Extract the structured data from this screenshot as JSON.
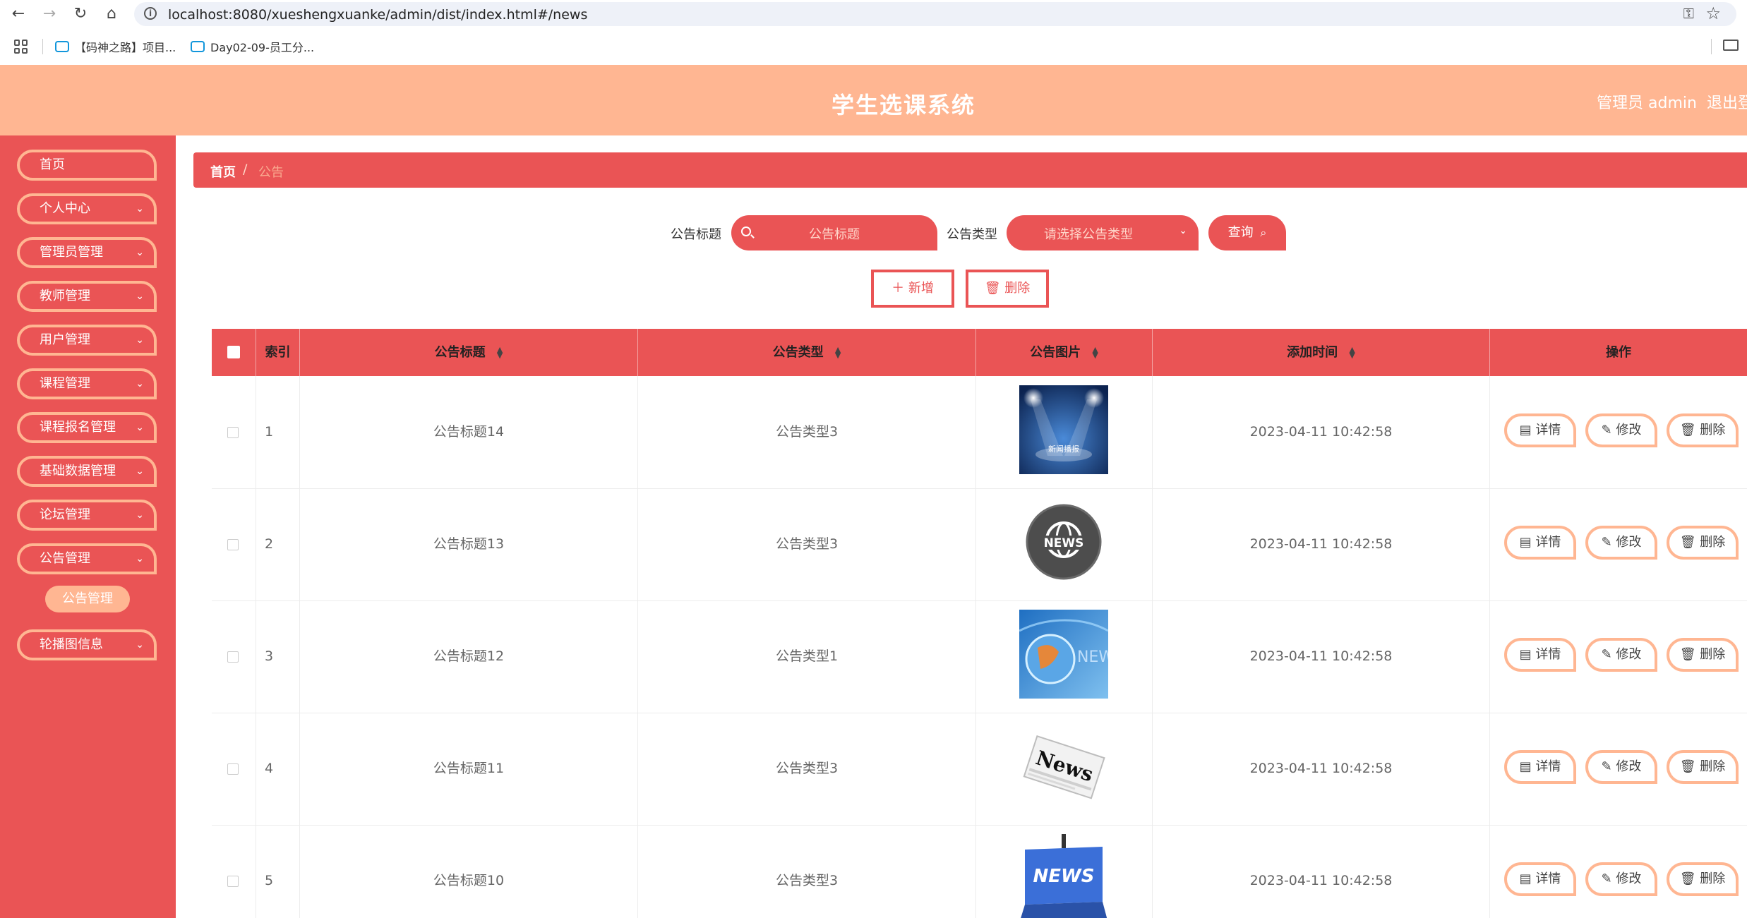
{
  "browser": {
    "url": "localhost:8080/xueshengxuanke/admin/dist/index.html#/news",
    "bookmarks": [
      "【码神之路】项目...",
      "Day02-09-员工分..."
    ]
  },
  "header": {
    "title": "学生选课系统",
    "admin_label": "管理员 admin",
    "logout_label": "退出登录"
  },
  "sidebar": {
    "items": [
      {
        "label": "首页"
      },
      {
        "label": "个人中心"
      },
      {
        "label": "管理员管理"
      },
      {
        "label": "教师管理"
      },
      {
        "label": "用户管理"
      },
      {
        "label": "课程管理"
      },
      {
        "label": "课程报名管理"
      },
      {
        "label": "基础数据管理"
      },
      {
        "label": "论坛管理"
      },
      {
        "label": "公告管理"
      },
      {
        "label": "轮播图信息"
      }
    ],
    "active_sub": "公告管理"
  },
  "breadcrumb": {
    "home": "首页",
    "separator": "/",
    "current": "公告"
  },
  "search": {
    "title_label": "公告标题",
    "title_placeholder": "公告标题",
    "type_label": "公告类型",
    "type_placeholder": "请选择公告类型",
    "query_button": "查询"
  },
  "actions": {
    "add": "新增",
    "delete": "删除"
  },
  "table": {
    "columns": [
      "索引",
      "公告标题",
      "公告类型",
      "公告图片",
      "添加时间",
      "操作"
    ],
    "rows": [
      {
        "index": "1",
        "title": "公告标题14",
        "type": "公告类型3",
        "image": "spotlight-news",
        "time": "2023-04-11 10:42:58"
      },
      {
        "index": "2",
        "title": "公告标题13",
        "type": "公告类型3",
        "image": "news-globe-badge",
        "time": "2023-04-11 10:42:58"
      },
      {
        "index": "3",
        "title": "公告标题12",
        "type": "公告类型1",
        "image": "blue-globe-news",
        "time": "2023-04-11 10:42:58"
      },
      {
        "index": "4",
        "title": "公告标题11",
        "type": "公告类型3",
        "image": "newspaper-news",
        "time": "2023-04-11 10:42:58"
      },
      {
        "index": "5",
        "title": "公告标题10",
        "type": "公告类型3",
        "image": "news-key",
        "time": "2023-04-11 10:42:58"
      }
    ],
    "row_actions": {
      "detail": "详情",
      "edit": "修改",
      "delete": "删除"
    },
    "image_texts": {
      "spotlight": "新闻播报",
      "news": "NEWS",
      "news_mixed": "News"
    }
  },
  "colors": {
    "primary": "#ea5455",
    "accent": "#ffb692"
  }
}
